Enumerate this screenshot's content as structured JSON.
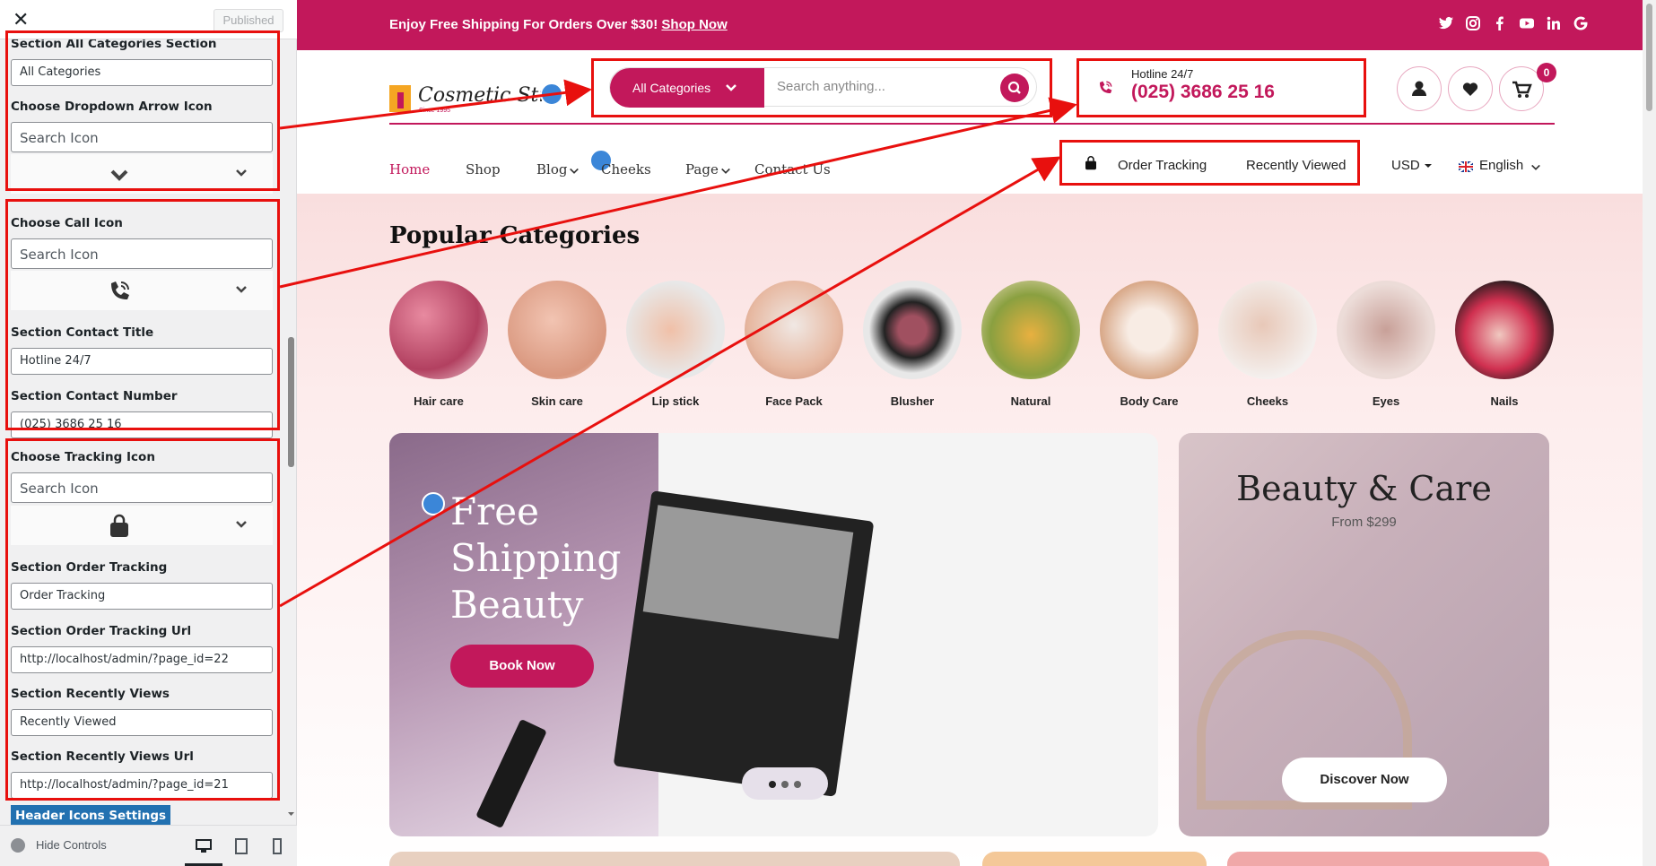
{
  "customizer": {
    "published_label": "Published",
    "fields": {
      "all_categories_label": "Section All Categories Section",
      "all_categories_value": "All Categories",
      "dropdown_icon_label": "Choose Dropdown Arrow Icon",
      "call_icon_label": "Choose Call Icon",
      "contact_title_label": "Section Contact Title",
      "contact_title_value": "Hotline 24/7",
      "contact_number_label": "Section Contact Number",
      "contact_number_value": "(025) 3686 25 16",
      "tracking_icon_label": "Choose Tracking Icon",
      "order_tracking_label": "Section Order Tracking",
      "order_tracking_value": "Order Tracking",
      "order_tracking_url_label": "Section Order Tracking Url",
      "order_tracking_url_value": "http://localhost/admin/?page_id=22",
      "recently_views_label": "Section Recently Views",
      "recently_views_value": "Recently Viewed",
      "recently_views_url_label": "Section Recently Views Url",
      "recently_views_url_value": "http://localhost/admin/?page_id=21"
    },
    "search_icon_placeholder": "Search Icon",
    "header_icons_tab": "Header Icons Settings",
    "hide_controls": "Hide Controls"
  },
  "site": {
    "topbar_text": "Enjoy Free Shipping For Orders Over $30!",
    "topbar_link": "Shop Now",
    "logo_text": "Cosmetic Str",
    "logo_sub": "Since 1995",
    "search": {
      "category": "All Categories",
      "placeholder": "Search anything..."
    },
    "hotline_title": "Hotline 24/7",
    "hotline_number": "(025) 3686 25 16",
    "cart_count": "0",
    "nav": [
      "Home",
      "Shop",
      "Blog",
      "Cheeks",
      "Page",
      "Contact Us"
    ],
    "order_tracking": "Order Tracking",
    "recently_viewed": "Recently Viewed",
    "currency": "USD",
    "language": "English",
    "popular_title": "Popular Categories",
    "categories": [
      "Hair care",
      "Skin care",
      "Lip stick",
      "Face Pack",
      "Blusher",
      "Natural",
      "Body Care",
      "Cheeks",
      "Eyes",
      "Nails"
    ],
    "banner1": {
      "title": "Free Shipping Beauty",
      "button": "Book Now"
    },
    "banner2": {
      "title": "Beauty & Care",
      "subtitle": "From $299",
      "button": "Discover Now"
    }
  },
  "colors": {
    "brand": "#c2185b",
    "annotation": "#e8100e",
    "wp_blue": "#2271b1"
  }
}
